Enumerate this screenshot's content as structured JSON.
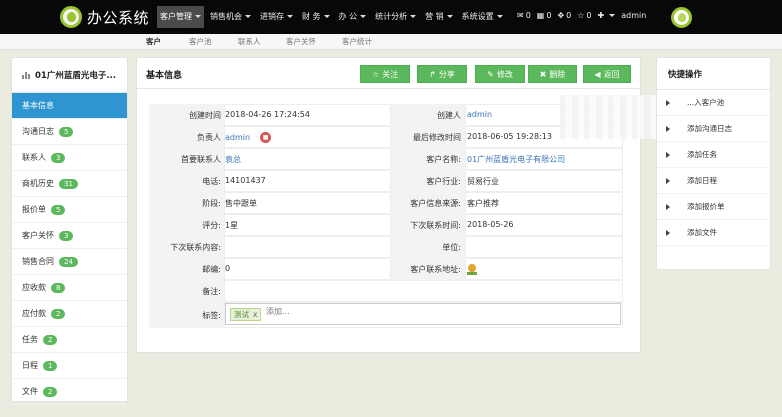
{
  "app": {
    "title": "办公系统",
    "brand_color": "#98c42d",
    "top_nav": [
      {
        "label": "客户管理",
        "active": true
      },
      {
        "label": "销售机会"
      },
      {
        "label": "进销存"
      },
      {
        "label": "财 务"
      },
      {
        "label": "办 公"
      },
      {
        "label": "统计分析"
      },
      {
        "label": "营 销"
      },
      {
        "label": "系统设置"
      }
    ],
    "status": {
      "mail_count": "0",
      "grid_count": "0",
      "gear_count": "0",
      "star_count": "0",
      "user": "admin"
    }
  },
  "sub_nav": [
    {
      "label": "客户",
      "active": true
    },
    {
      "label": "客户池"
    },
    {
      "label": "联系人"
    },
    {
      "label": "客户关怀"
    },
    {
      "label": "客户统计"
    }
  ],
  "sidebar": {
    "title": "01广州蓝盾光电子...",
    "items": [
      {
        "label": "基本信息",
        "active": true
      },
      {
        "label": "沟通日志",
        "count": "5"
      },
      {
        "label": "联系人",
        "count": "3"
      },
      {
        "label": "商机历史",
        "count": "31"
      },
      {
        "label": "报价单",
        "count": "5"
      },
      {
        "label": "客户关怀",
        "count": "3"
      },
      {
        "label": "销售合同",
        "count": "24"
      },
      {
        "label": "应收款",
        "count": "8"
      },
      {
        "label": "应付款",
        "count": "2"
      },
      {
        "label": "任务",
        "count": "2"
      },
      {
        "label": "日程",
        "count": "1"
      },
      {
        "label": "文件",
        "count": "2"
      }
    ]
  },
  "main": {
    "title": "基本信息",
    "buttons": {
      "follow": "关注",
      "share": "分享",
      "edit": "修改",
      "delete": "删除",
      "back": "返回"
    },
    "fields": {
      "created_time_label": "创建时间",
      "created_time": "2018-04-26 17:24:54",
      "creator_label": "创建人",
      "creator": "admin",
      "owner_label": "负责人",
      "owner": "admin",
      "last_modified_label": "最后修改时间",
      "last_modified": "2018-06-05 19:28:13",
      "primary_contact_label": "首要联系人",
      "primary_contact": "袁总",
      "customer_name_label": "客户名称:",
      "customer_name": "01广州蓝盾光电子有限公司",
      "phone_label": "电话:",
      "phone": "14101437",
      "industry_label": "客户行业:",
      "industry": "贸易行业",
      "stage_label": "阶段:",
      "stage": "售中跟单",
      "source_label": "客户信息来源:",
      "source": "客户推荐",
      "rating_label": "评分:",
      "rating": "1星",
      "next_contact_time_label": "下次联系时间:",
      "next_contact_time": "2018-05-26",
      "next_contact_content_label": "下次联系内容:",
      "unit_label": "单位:",
      "postcode_label": "邮编:",
      "postcode": "0",
      "address_label": "客户联系地址:",
      "remark_label": "备注:",
      "tags_label": "标签:",
      "tag": "测试",
      "tag_remove": "x",
      "tag_placeholder": "添加..."
    }
  },
  "quick_actions": {
    "title": "快捷操作",
    "items": [
      {
        "label": "...入客户池"
      },
      {
        "label": "添加沟通日志"
      },
      {
        "label": "添加任务"
      },
      {
        "label": "添加日程"
      },
      {
        "label": "添加报价单"
      },
      {
        "label": "添加文件"
      }
    ]
  }
}
